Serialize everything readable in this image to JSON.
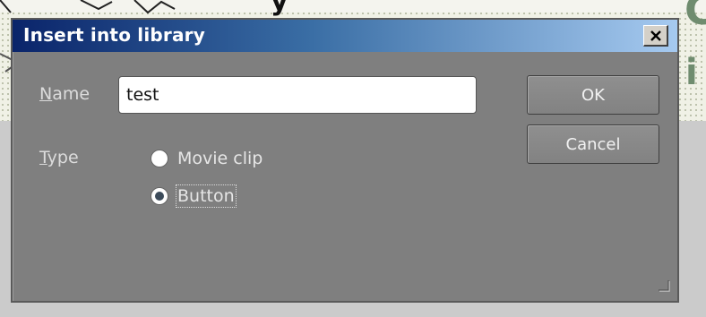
{
  "background": {
    "title_fragment": "y",
    "right_letters_top": "C",
    "right_letters_bottom": "i"
  },
  "dialog": {
    "title": "Insert into library",
    "close_glyph": "✕",
    "name_label_mnemonic": "N",
    "name_label_rest": "ame",
    "name_value": "test",
    "type_label_mnemonic": "T",
    "type_label_rest": "ype",
    "type_options": [
      {
        "label": "Movie clip",
        "checked": false
      },
      {
        "label": "Button",
        "checked": true
      }
    ],
    "ok_label": "OK",
    "cancel_label": "Cancel"
  },
  "colors": {
    "dialog_body": "#7f7f7f",
    "titlebar_start": "#0a246a",
    "titlebar_end": "#a6caf0"
  },
  "icons": {
    "close": "close-icon",
    "resize": "resize-grip-icon"
  }
}
